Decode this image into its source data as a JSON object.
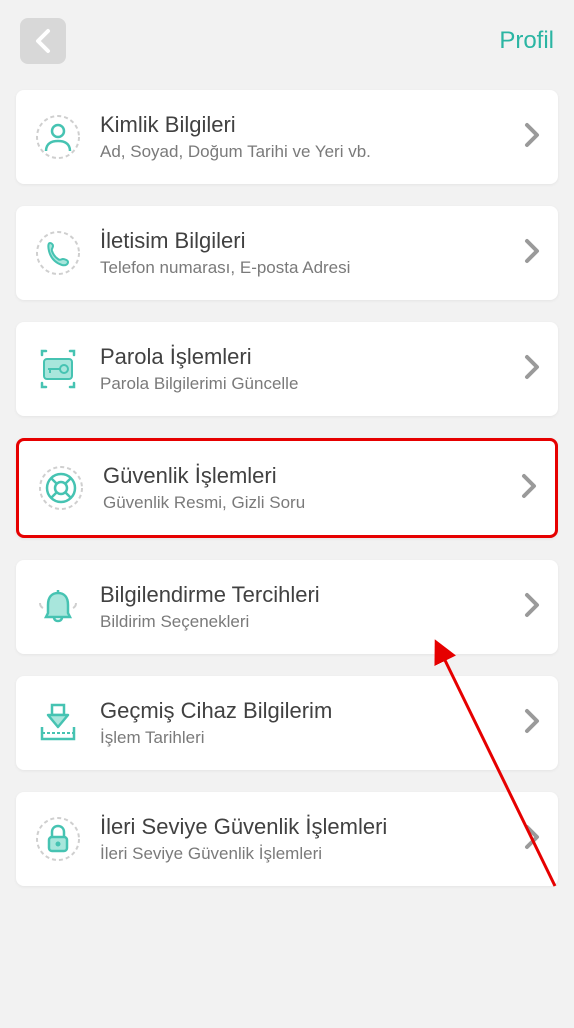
{
  "header": {
    "profile_label": "Profil"
  },
  "items": [
    {
      "title": "Kimlik Bilgileri",
      "subtitle": "Ad, Soyad, Doğum Tarihi ve Yeri vb."
    },
    {
      "title": "İletisim Bilgileri",
      "subtitle": "Telefon numarası, E-posta Adresi"
    },
    {
      "title": "Parola İşlemleri",
      "subtitle": "Parola Bilgilerimi Güncelle"
    },
    {
      "title": "Güvenlik İşlemleri",
      "subtitle": "Güvenlik Resmi, Gizli Soru"
    },
    {
      "title": "Bilgilendirme Tercihleri",
      "subtitle": "Bildirim Seçenekleri"
    },
    {
      "title": "Geçmiş Cihaz Bilgilerim",
      "subtitle": "İşlem Tarihleri"
    },
    {
      "title": "İleri Seviye Güvenlik İşlemleri",
      "subtitle": "İleri Seviye Güvenlik İşlemleri"
    }
  ]
}
